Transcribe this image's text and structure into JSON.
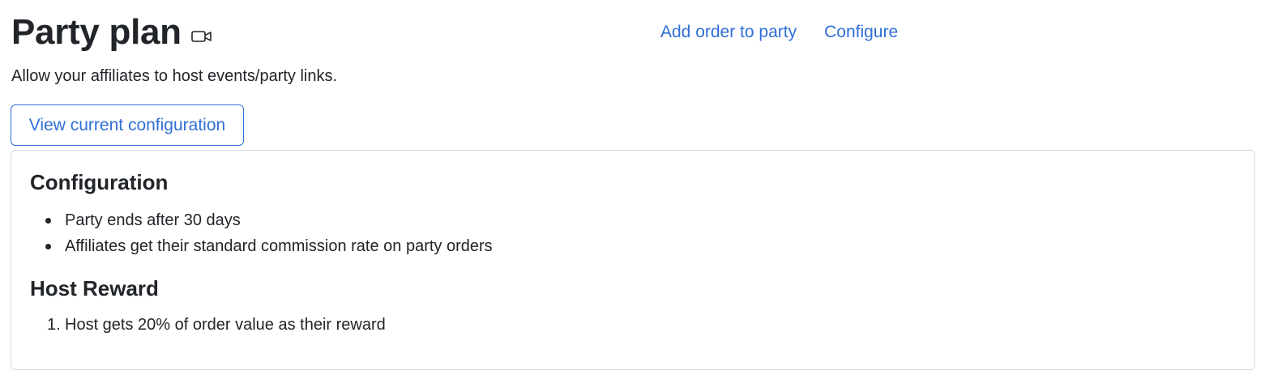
{
  "header": {
    "title": "Party plan",
    "video_icon": "video-camera-icon",
    "links": {
      "add_order": "Add order to party",
      "configure": "Configure"
    },
    "subtitle": "Allow your affiliates to host events/party links."
  },
  "view_config_button": "View current configuration",
  "config_panel": {
    "configuration_heading": "Configuration",
    "configuration_items": [
      "Party ends after 30 days",
      "Affiliates get their standard commission rate on party orders"
    ],
    "host_reward_heading": "Host Reward",
    "host_reward_items": [
      {
        "marker": "1.",
        "text": "Host gets 20% of order value as their reward"
      }
    ]
  },
  "colors": {
    "link": "#2f6fd6",
    "text": "#212529",
    "panel_border": "#d6d9dc"
  }
}
